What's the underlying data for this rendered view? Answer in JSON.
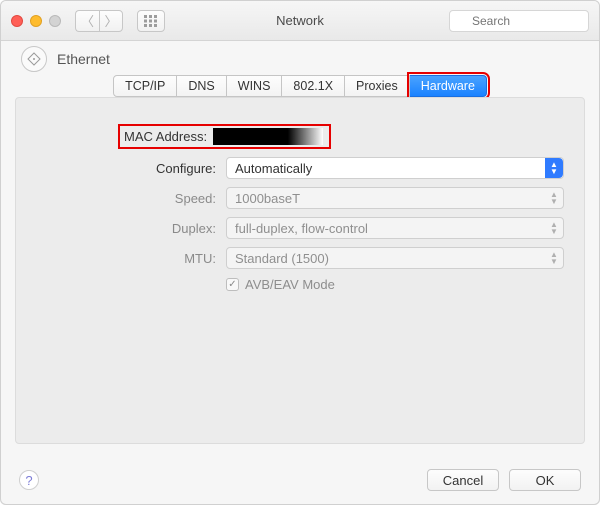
{
  "window": {
    "title": "Network",
    "search_placeholder": "Search"
  },
  "breadcrumb": {
    "label": "Ethernet"
  },
  "tabs": [
    {
      "label": "TCP/IP",
      "active": false
    },
    {
      "label": "DNS",
      "active": false
    },
    {
      "label": "WINS",
      "active": false
    },
    {
      "label": "802.1X",
      "active": false
    },
    {
      "label": "Proxies",
      "active": false
    },
    {
      "label": "Hardware",
      "active": true
    }
  ],
  "form": {
    "mac_label": "MAC Address:",
    "mac_value": "",
    "configure_label": "Configure:",
    "configure_value": "Automatically",
    "speed_label": "Speed:",
    "speed_value": "1000baseT",
    "duplex_label": "Duplex:",
    "duplex_value": "full-duplex, flow-control",
    "mtu_label": "MTU:",
    "mtu_value": "Standard  (1500)",
    "avb_label": "AVB/EAV Mode",
    "avb_checked": true
  },
  "footer": {
    "cancel": "Cancel",
    "ok": "OK"
  }
}
